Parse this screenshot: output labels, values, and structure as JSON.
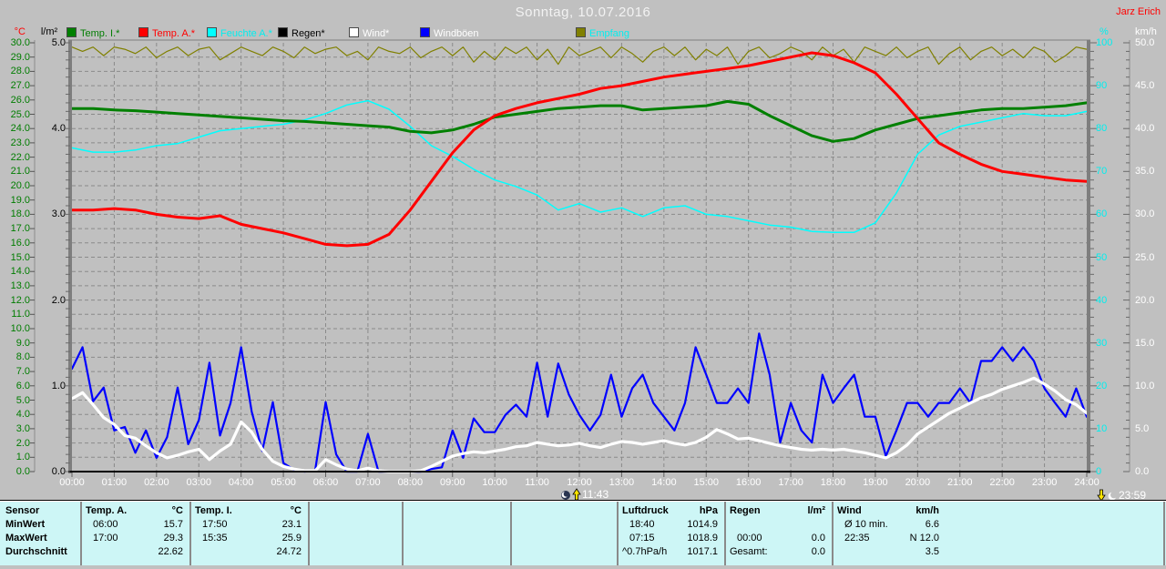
{
  "header": {
    "title": "Sonntag, 10.07.2016",
    "watermark": "Jarz Erich"
  },
  "legend": {
    "items": [
      {
        "label": "Temp. I.*",
        "swatch": "#008000",
        "text_color": "#007d00"
      },
      {
        "label": "Temp. A.*",
        "swatch": "#ff0000",
        "text_color": "#ff0000"
      },
      {
        "label": "Feuchte A.*",
        "swatch": "#00ffff",
        "text_color": "#00efef"
      },
      {
        "label": "Regen*",
        "swatch": "#000000",
        "text_color": "#000000"
      },
      {
        "label": "Wind*",
        "swatch": "#ffffff",
        "text_color": "#ffffff"
      },
      {
        "label": "Windböen",
        "swatch": "#0000ff",
        "text_color": "#ffffff"
      },
      {
        "label": "Empfang",
        "swatch": "#808000",
        "text_color": "#00efef"
      }
    ]
  },
  "axes": {
    "temp": {
      "unit": "°C",
      "min": 0,
      "max": 30,
      "step": 1,
      "ticks": [
        "30.0",
        "29.0",
        "28.0",
        "27.0",
        "26.0",
        "25.0",
        "24.0",
        "23.0",
        "22.0",
        "21.0",
        "20.0",
        "19.0",
        "18.0",
        "17.0",
        "16.0",
        "15.0",
        "14.0",
        "13.0",
        "12.0",
        "11.0",
        "10.0",
        "9.0",
        "8.0",
        "7.0",
        "6.0",
        "5.0",
        "4.0",
        "3.0",
        "2.0",
        "1.0",
        "0.0"
      ]
    },
    "rain": {
      "unit": "l/m²",
      "min": 0,
      "max": 5,
      "step": 1,
      "ticks": [
        "5.0",
        "4.0",
        "3.0",
        "2.0",
        "1.0",
        "0.0"
      ]
    },
    "humidity": {
      "unit": "%",
      "min": 0,
      "max": 100,
      "step": 10,
      "ticks": [
        "100",
        "90",
        "80",
        "70",
        "60",
        "50",
        "40",
        "30",
        "20",
        "10",
        "0"
      ]
    },
    "wind": {
      "unit": "km/h",
      "min": 0,
      "max": 50,
      "step": 5,
      "ticks": [
        "50.0",
        "45.0",
        "40.0",
        "35.0",
        "30.0",
        "25.0",
        "20.0",
        "15.0",
        "10.0",
        "5.0",
        "0.0"
      ]
    },
    "time": {
      "ticks": [
        "00:00",
        "01:00",
        "02:00",
        "03:00",
        "04:00",
        "05:00",
        "06:00",
        "07:00",
        "08:00",
        "09:00",
        "10:00",
        "11:00",
        "12:00",
        "13:00",
        "14:00",
        "15:00",
        "16:00",
        "17:00",
        "18:00",
        "19:00",
        "20:00",
        "21:00",
        "22:00",
        "23:00",
        "24:00"
      ]
    }
  },
  "markers": {
    "midday": {
      "time": "11:43"
    },
    "end": {
      "time": "23:59"
    }
  },
  "chart_data": {
    "type": "line",
    "title": "Sonntag, 10.07.2016",
    "x_unit": "hours",
    "x_range": [
      0,
      24
    ],
    "grid": {
      "horizontal_step_c": 1,
      "vertical_step_h": 1
    },
    "series": [
      {
        "name": "Empfang",
        "color": "#808000",
        "axis": "percent",
        "x_step_h": 0.25,
        "values": [
          99,
          98,
          99,
          97,
          99,
          98.5,
          97.5,
          99,
          96.5,
          98,
          99,
          97,
          98.5,
          99,
          96,
          97.5,
          99,
          98,
          97,
          99,
          98,
          96.5,
          99,
          97.5,
          98.5,
          99,
          97,
          98,
          96,
          99,
          98,
          97.5,
          99,
          96.5,
          98,
          99,
          97,
          99,
          95.5,
          98,
          96,
          99,
          97.5,
          99,
          96,
          98.5,
          95,
          99,
          97,
          98,
          99,
          96.5,
          99,
          97.5,
          95.5,
          98,
          99,
          97,
          99,
          96,
          98.5,
          97,
          99,
          95,
          98,
          99,
          96.5,
          97.5,
          99,
          98,
          96,
          99,
          97,
          98.5,
          95.5,
          99,
          98,
          97,
          99,
          96.5,
          98,
          99,
          95,
          97.5,
          99,
          96,
          98,
          99,
          97,
          98.5,
          96.5,
          99,
          98,
          95.5,
          97,
          99,
          98.5
        ]
      },
      {
        "name": "Feuchte A.*",
        "color": "#00ffff",
        "axis": "percent",
        "x_step_h": 0.5,
        "values": [
          75.5,
          74.5,
          74.5,
          75,
          76,
          76.5,
          78,
          79.5,
          80,
          80.5,
          81,
          82,
          83.5,
          85.5,
          86.5,
          84.5,
          80.5,
          76,
          73.5,
          70.5,
          68,
          66.5,
          64.5,
          61,
          62.5,
          60.5,
          61.5,
          59.5,
          61.5,
          62,
          60,
          59.5,
          58.5,
          57.5,
          57,
          56,
          55.8,
          55.8,
          58,
          65,
          74,
          78.5,
          80.5,
          81.5,
          82.5,
          83.5,
          83,
          83,
          84
        ]
      },
      {
        "name": "Temp. I.*",
        "color": "#008000",
        "axis": "temp_c",
        "x_step_h": 0.5,
        "values": [
          25.4,
          25.4,
          25.3,
          25.25,
          25.15,
          25.05,
          24.95,
          24.85,
          24.75,
          24.65,
          24.55,
          24.5,
          24.4,
          24.3,
          24.2,
          24.1,
          23.8,
          23.7,
          23.9,
          24.3,
          24.8,
          25,
          25.2,
          25.4,
          25.5,
          25.6,
          25.6,
          25.3,
          25.4,
          25.5,
          25.6,
          25.9,
          25.7,
          24.9,
          24.2,
          23.5,
          23.1,
          23.3,
          23.9,
          24.3,
          24.7,
          24.9,
          25.1,
          25.3,
          25.4,
          25.4,
          25.5,
          25.6,
          25.8
        ]
      },
      {
        "name": "Temp. A.*",
        "color": "#ff0000",
        "axis": "temp_c",
        "x_step_h": 0.5,
        "values": [
          18.3,
          18.3,
          18.4,
          18.3,
          18,
          17.8,
          17.7,
          17.9,
          17.3,
          17,
          16.7,
          16.3,
          15.9,
          15.8,
          15.9,
          16.6,
          18.3,
          20.3,
          22.3,
          23.9,
          24.9,
          25.4,
          25.8,
          26.1,
          26.4,
          26.8,
          27,
          27.3,
          27.6,
          27.8,
          28,
          28.2,
          28.4,
          28.7,
          29,
          29.3,
          29.1,
          28.6,
          27.9,
          26.4,
          24.7,
          23,
          22.2,
          21.5,
          21,
          20.8,
          20.6,
          20.4,
          20.3
        ]
      },
      {
        "name": "Regen*",
        "color": "#000000",
        "axis": "rain_lm2",
        "x_step_h": 24,
        "values": [
          0,
          0
        ]
      },
      {
        "name": "Windböen",
        "color": "#0000ff",
        "axis": "kmh",
        "x_step_h": 0.25,
        "values": [
          12,
          14.5,
          8.2,
          9.8,
          4.8,
          5.2,
          2.2,
          4.8,
          1.6,
          4,
          9.8,
          3.2,
          6,
          12.7,
          4.2,
          8,
          14.5,
          7,
          2.4,
          8.1,
          1,
          0.2,
          0,
          0.1,
          8.1,
          2,
          0,
          0,
          4.4,
          0,
          0,
          0,
          0,
          0,
          0.3,
          0.5,
          4.8,
          1.6,
          6.2,
          4.6,
          4.6,
          6.6,
          7.8,
          6.4,
          12.7,
          6.4,
          12.6,
          9,
          6.6,
          4.8,
          6.6,
          11.3,
          6.4,
          9.7,
          11.3,
          8,
          6.4,
          4.8,
          8,
          14.5,
          11.3,
          8,
          8,
          9.7,
          8,
          16.1,
          11.3,
          3.4,
          8,
          4.8,
          3.4,
          11.3,
          8,
          9.7,
          11.3,
          6.4,
          6.4,
          1.8,
          4.8,
          8,
          8,
          6.4,
          8,
          8,
          9.7,
          8,
          12.9,
          12.9,
          14.5,
          12.9,
          14.5,
          12.9,
          9.7,
          8,
          6.4,
          9.7,
          6.4
        ]
      },
      {
        "name": "Wind*",
        "color": "#ffffff",
        "axis": "kmh",
        "x_step_h": 0.25,
        "values": [
          8.5,
          9.2,
          7.8,
          6.3,
          5.5,
          4.2,
          3.9,
          3,
          2.2,
          1.6,
          1.9,
          2.3,
          2.6,
          1.4,
          2.4,
          3.2,
          5.8,
          4.6,
          2.6,
          1.2,
          0.6,
          0.3,
          0.1,
          0.1,
          1.4,
          0.8,
          0.3,
          0.1,
          0.4,
          0.1,
          0,
          0,
          0,
          0.1,
          0.6,
          1.2,
          1.8,
          2.1,
          2.3,
          2.2,
          2.4,
          2.6,
          2.9,
          3,
          3.4,
          3.2,
          3,
          3.1,
          3.3,
          3,
          2.8,
          3.2,
          3.5,
          3.4,
          3.2,
          3.4,
          3.6,
          3.3,
          3.1,
          3.4,
          4,
          4.9,
          4.4,
          3.8,
          3.9,
          3.6,
          3.3,
          3,
          2.8,
          2.6,
          2.5,
          2.6,
          2.5,
          2.6,
          2.4,
          2.2,
          1.9,
          1.6,
          2.2,
          3.1,
          4.4,
          5.2,
          6,
          6.8,
          7.4,
          8,
          8.6,
          9,
          9.6,
          10,
          10.4,
          10.9,
          10.2,
          9.4,
          8.4,
          7.8,
          6.8
        ]
      }
    ]
  },
  "table": {
    "row_labels": [
      "Sensor",
      "MinWert",
      "MaxWert",
      "Durchschnitt"
    ],
    "columns": [
      {
        "name": "Temp. A.",
        "unit": "°C",
        "rows": [
          [
            "06:00",
            "15.7"
          ],
          [
            "17:00",
            "29.3"
          ],
          [
            "",
            "22.62"
          ]
        ]
      },
      {
        "name": "Temp. I.",
        "unit": "°C",
        "rows": [
          [
            "17:50",
            "23.1"
          ],
          [
            "15:35",
            "25.9"
          ],
          [
            "",
            "24.72"
          ]
        ]
      },
      {
        "name": "",
        "unit": "",
        "rows": [
          [
            "",
            ""
          ],
          [
            "",
            ""
          ],
          [
            "",
            ""
          ]
        ]
      },
      {
        "name": "",
        "unit": "",
        "rows": [
          [
            "",
            ""
          ],
          [
            "",
            ""
          ],
          [
            "",
            ""
          ]
        ]
      },
      {
        "name": "",
        "unit": "",
        "rows": [
          [
            "",
            ""
          ],
          [
            "",
            ""
          ],
          [
            "",
            ""
          ]
        ]
      },
      {
        "name": "Luftdruck",
        "unit": "hPa",
        "rows": [
          [
            "18:40",
            "1014.9"
          ],
          [
            "07:15",
            "1018.9"
          ],
          [
            "^0.7hPa/h",
            "1017.1"
          ]
        ]
      },
      {
        "name": "Regen",
        "unit": "l/m²",
        "rows": [
          [
            "",
            ""
          ],
          [
            "00:00",
            "0.0"
          ],
          [
            "Gesamt:",
            "0.0"
          ]
        ]
      },
      {
        "name": "Wind",
        "unit": "km/h",
        "rows": [
          [
            "Ø 10 min.",
            "6.6"
          ],
          [
            "22:35",
            "N 12.0"
          ],
          [
            "",
            "3.5"
          ]
        ]
      }
    ]
  }
}
